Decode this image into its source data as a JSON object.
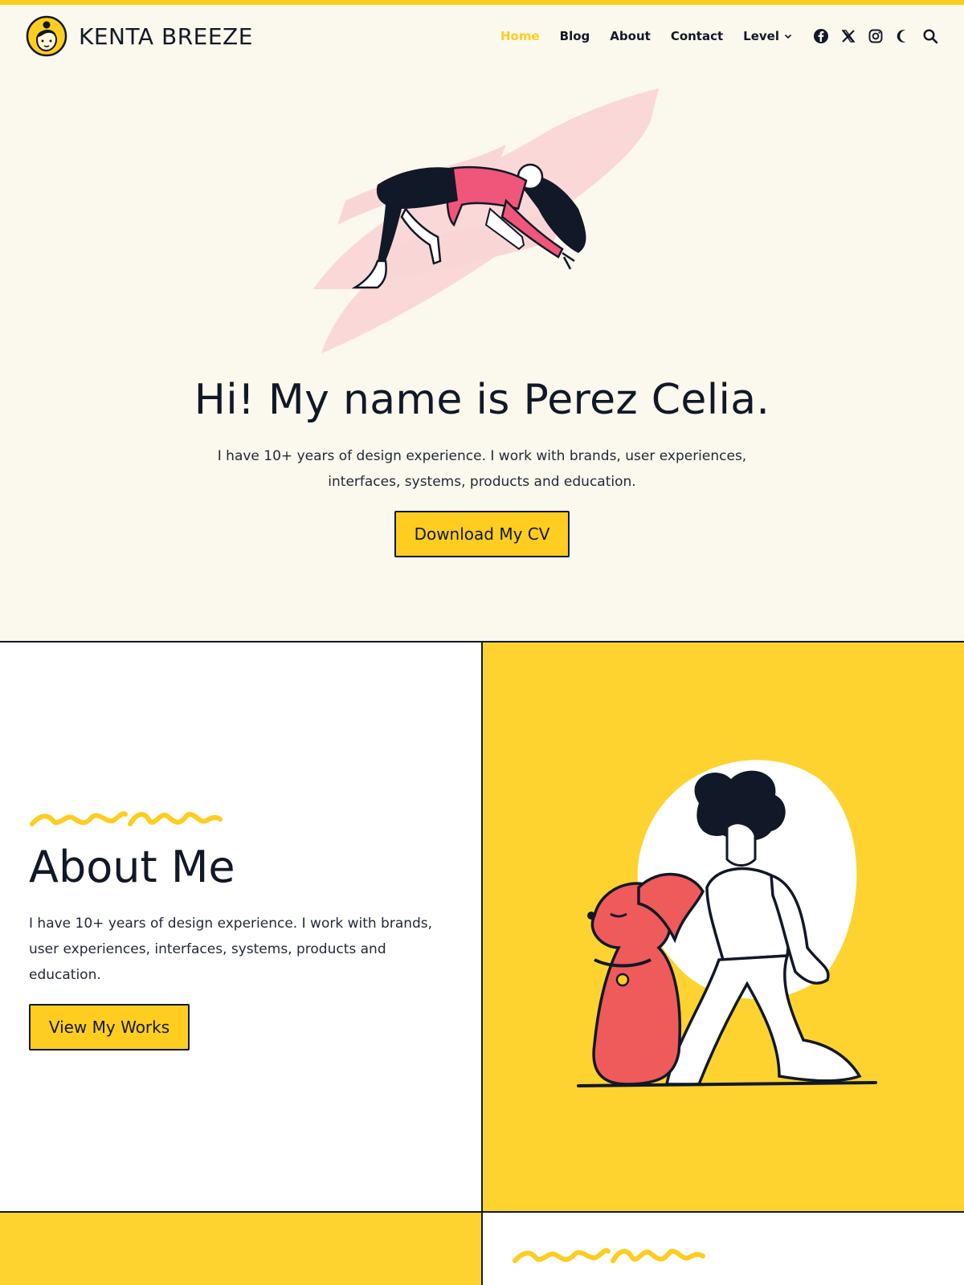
{
  "site": {
    "title": "KENTA BREEZE",
    "accent_color": "#fecd20"
  },
  "nav": {
    "items": [
      {
        "label": "Home",
        "active": true
      },
      {
        "label": "Blog"
      },
      {
        "label": "About"
      },
      {
        "label": "Contact"
      },
      {
        "label": "Level",
        "has_dropdown": true
      }
    ],
    "icons": [
      "facebook-icon",
      "x-twitter-icon",
      "instagram-icon",
      "moon-icon",
      "search-icon"
    ]
  },
  "hero": {
    "title": "Hi! My name is Perez Celia.",
    "text": "I have 10+ years of design experience. I work with brands, user experiences, interfaces, systems, products and education.",
    "button_label": "Download My CV"
  },
  "about": {
    "title": "About Me",
    "text": "I have 10+ years of design experience. I work with brands, user experiences, interfaces, systems, products and education.",
    "button_label": "View My Works"
  }
}
